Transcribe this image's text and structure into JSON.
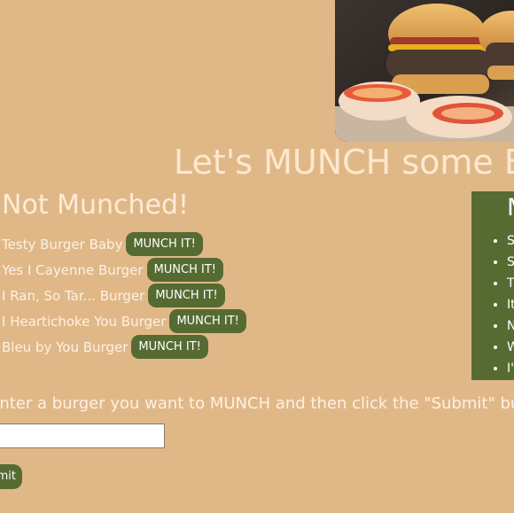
{
  "header": {
    "title": "Let's MUNCH some Burgers!"
  },
  "not_munched": {
    "title": "Not Munched!",
    "items": [
      {
        "name": "Testy Burger Baby",
        "button_label": "MUNCH IT!"
      },
      {
        "name": "Yes I Cayenne Burger",
        "button_label": "MUNCH IT!"
      },
      {
        "name": "I Ran, So Tar... Burger",
        "button_label": "MUNCH IT!"
      },
      {
        "name": "I Heartichoke You Burger",
        "button_label": "MUNCH IT!"
      },
      {
        "name": "Bleu by You Burger",
        "button_label": "MUNCH IT!"
      }
    ]
  },
  "munched": {
    "title": "Munched!",
    "items": [
      "S",
      "S",
      "T",
      "It",
      "N",
      "W",
      "I'"
    ]
  },
  "form": {
    "instructions": "Enter a burger you want to MUNCH and then click the \"Submit\" button!",
    "input_value": "",
    "input_placeholder": "",
    "submit_label": "Submit"
  },
  "colors": {
    "background": "#e0b888",
    "accent": "#566b32",
    "heading_text": "#fde8cf"
  },
  "icons": {
    "hero": "burger-photo"
  }
}
